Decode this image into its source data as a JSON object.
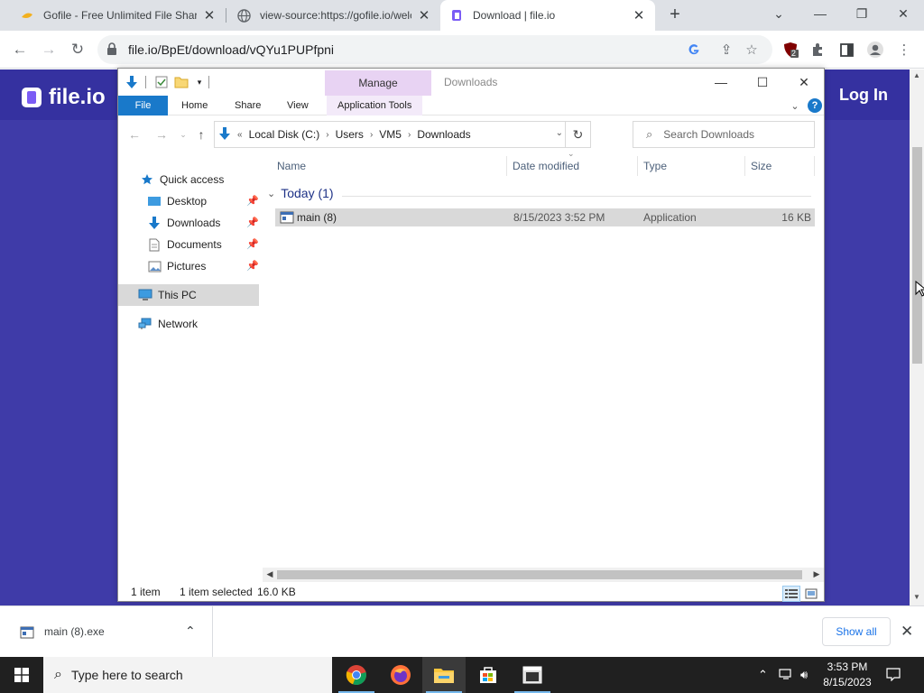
{
  "browser": {
    "tabs": [
      {
        "title": "Gofile - Free Unlimited File Sharing",
        "active": false
      },
      {
        "title": "view-source:https://gofile.io/welcome",
        "active": false
      },
      {
        "title": "Download | file.io",
        "active": true
      }
    ],
    "url": "file.io/BpEt/download/vQYu1PUPfpni",
    "extension_badge": "2"
  },
  "page": {
    "logo_text": "file.io",
    "login_label": "Log In",
    "background_color": "#3f3ba8"
  },
  "explorer": {
    "window_title": "Downloads",
    "contextual_tab": "Manage",
    "ribbon_tabs": [
      "File",
      "Home",
      "Share",
      "View",
      "Application Tools"
    ],
    "breadcrumb": [
      "Local Disk (C:)",
      "Users",
      "VM5",
      "Downloads"
    ],
    "search_placeholder": "Search Downloads",
    "nav": {
      "quick_access": "Quick access",
      "desktop": "Desktop",
      "downloads": "Downloads",
      "documents": "Documents",
      "pictures": "Pictures",
      "this_pc": "This PC",
      "network": "Network"
    },
    "columns": [
      "Name",
      "Date modified",
      "Type",
      "Size"
    ],
    "group_label": "Today (1)",
    "files": [
      {
        "name": "main (8)",
        "date_modified": "8/15/2023 3:52 PM",
        "type": "Application",
        "size": "16 KB"
      }
    ],
    "status": {
      "count": "1 item",
      "selection": "1 item selected",
      "selection_size": "16.0 KB"
    }
  },
  "download_shelf": {
    "filename": "main (8).exe",
    "show_all_label": "Show all"
  },
  "taskbar": {
    "search_placeholder": "Type here to search",
    "time": "3:53 PM",
    "date": "8/15/2023"
  },
  "colors": {
    "chrome_tabstrip": "#dee1e6",
    "explorer_accent": "#1979ca",
    "manage_tab": "#e8d3f3",
    "taskbar": "#202020"
  }
}
